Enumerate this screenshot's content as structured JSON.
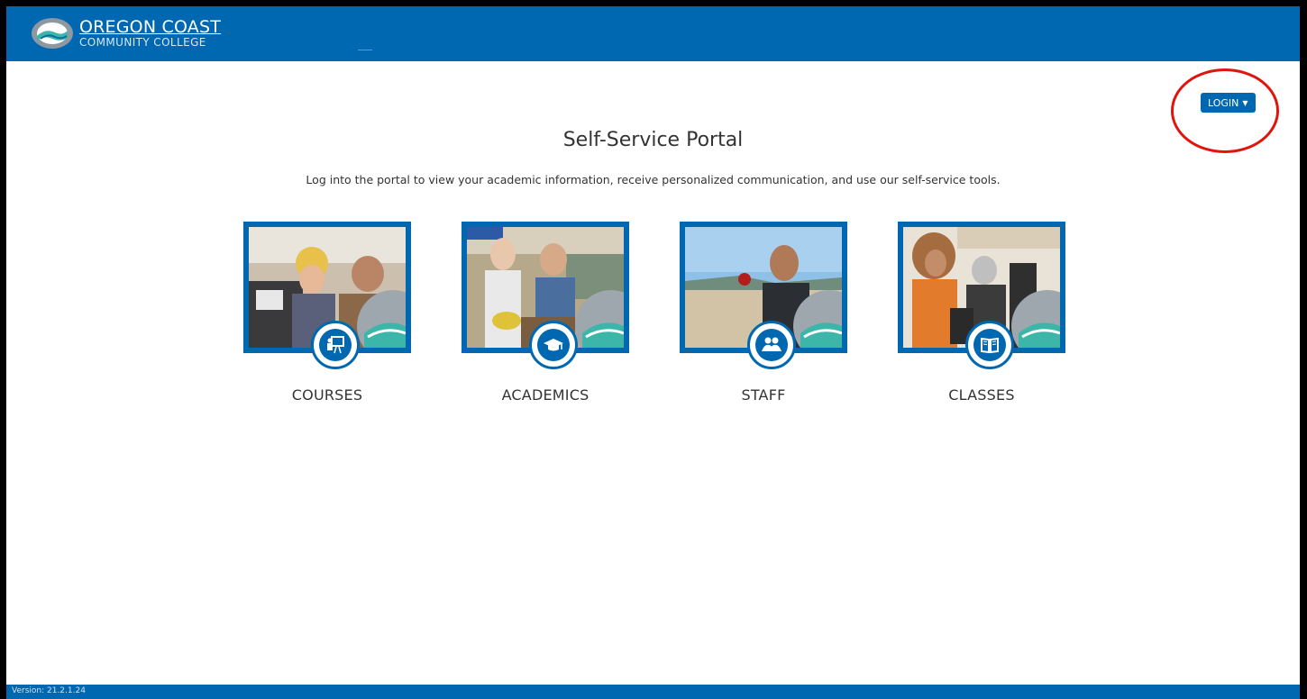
{
  "header": {
    "logo_line1": "OREGON COAST",
    "logo_line2": "COMMUNITY COLLEGE"
  },
  "login": {
    "label": "LOGIN"
  },
  "main": {
    "title": "Self-Service Portal",
    "description": "Log into the portal to view your academic information, receive personalized communication, and use our self-service tools."
  },
  "tiles": [
    {
      "label": "COURSES",
      "icon": "presentation-icon"
    },
    {
      "label": "ACADEMICS",
      "icon": "graduation-cap-icon"
    },
    {
      "label": "STAFF",
      "icon": "people-icon"
    },
    {
      "label": "CLASSES",
      "icon": "book-icon"
    }
  ],
  "footer": {
    "version": "Version: 21.2.1.24"
  },
  "colors": {
    "brand": "#0067b1",
    "annotation": "#e1140c",
    "teal": "#3bb6a9"
  }
}
